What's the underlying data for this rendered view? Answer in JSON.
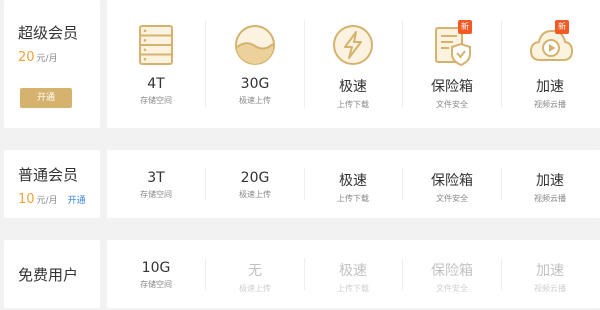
{
  "colors": {
    "gold": "#d5b26d",
    "price": "#f1a33a",
    "link": "#3a87e0",
    "badge": "#f15a24"
  },
  "tiers": [
    {
      "name": "超级会员",
      "price": "20",
      "unit": "元/月",
      "action": "开通",
      "features": [
        {
          "value": "4T",
          "desc": "存储空间",
          "icon": "storage-icon"
        },
        {
          "value": "30G",
          "desc": "极速上传",
          "icon": "upload-icon"
        },
        {
          "value": "极速",
          "desc": "上传下载",
          "icon": "lightning-icon"
        },
        {
          "value": "保险箱",
          "desc": "文件安全",
          "icon": "safe-icon",
          "badge": "新"
        },
        {
          "value": "加速",
          "desc": "视频云播",
          "icon": "cloud-play-icon",
          "badge": "新"
        }
      ]
    },
    {
      "name": "普通会员",
      "price": "10",
      "unit": "元/月",
      "action": "开通",
      "features": [
        {
          "value": "3T",
          "desc": "存储空间"
        },
        {
          "value": "20G",
          "desc": "极速上传"
        },
        {
          "value": "极速",
          "desc": "上传下载"
        },
        {
          "value": "保险箱",
          "desc": "文件安全"
        },
        {
          "value": "加速",
          "desc": "视频云播"
        }
      ]
    },
    {
      "name": "免费用户",
      "features": [
        {
          "value": "10G",
          "desc": "存储空间"
        },
        {
          "value": "无",
          "desc": "极速上传",
          "unavailable": true
        },
        {
          "value": "极速",
          "desc": "上传下载",
          "unavailable": true
        },
        {
          "value": "保险箱",
          "desc": "文件安全",
          "unavailable": true
        },
        {
          "value": "加速",
          "desc": "视频云播",
          "unavailable": true
        }
      ]
    }
  ]
}
